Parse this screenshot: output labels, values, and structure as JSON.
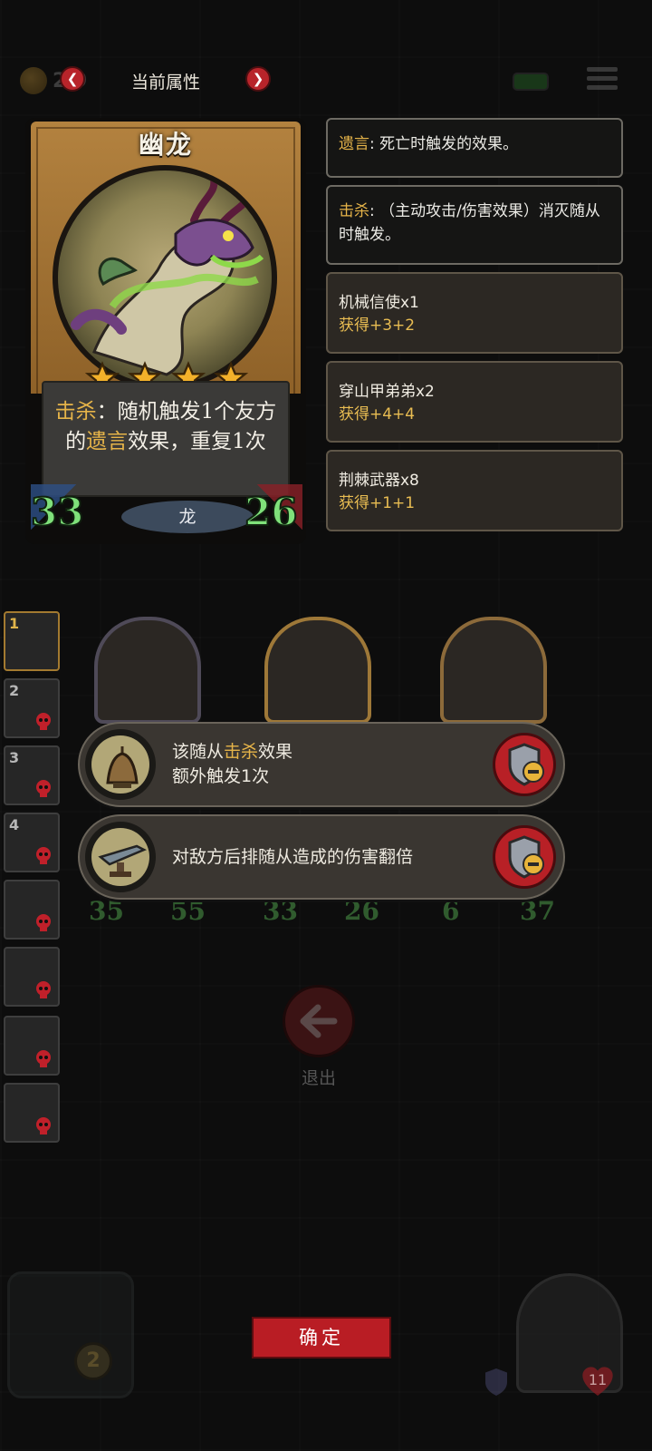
{
  "top_bar": {
    "coin_count": "2 9",
    "title": "当前属性",
    "prev_glyph": "❮",
    "next_glyph": "❯"
  },
  "card": {
    "name": "幽龙",
    "stars": 4,
    "desc_keyword1": "击杀",
    "desc_part1": "：随机触发1个友方的",
    "desc_keyword2": "遗言",
    "desc_part2": "效果，重复1次",
    "tribe": "龙",
    "attack": "33",
    "health": "26"
  },
  "keywords": [
    {
      "term": "遗言",
      "text": ": 死亡时触发的效果。"
    },
    {
      "term": "击杀",
      "text": ": （主动攻击/伤害效果）消灭随从时触发。"
    }
  ],
  "buffs": [
    {
      "name": "机械信使x1",
      "gain": "获得+3+2"
    },
    {
      "name": "穿山甲弟弟x2",
      "gain": "获得+4+4"
    },
    {
      "name": "荆棘武器x8",
      "gain": "获得+1+1"
    }
  ],
  "side_slots": [
    "1",
    "2",
    "3",
    "4",
    "",
    "",
    "",
    ""
  ],
  "board_stats": [
    {
      "atk": "35",
      "hp": "55"
    },
    {
      "atk": "33",
      "hp": "26"
    },
    {
      "atk": "6",
      "hp": "37"
    }
  ],
  "bonuses": [
    {
      "pre": "该随从",
      "keyword": "击杀",
      "post": "效果",
      "line2": "额外触发1次"
    },
    {
      "text": "对敌方后排随从造成的伤害翻倍"
    }
  ],
  "exit_label": "退出",
  "confirm_label": "确定",
  "hero": {
    "level": "2",
    "life": "11"
  },
  "colors": {
    "keyword": "#e6b449",
    "stat_green": "#7fe07a",
    "button_red": "#b91d24"
  }
}
